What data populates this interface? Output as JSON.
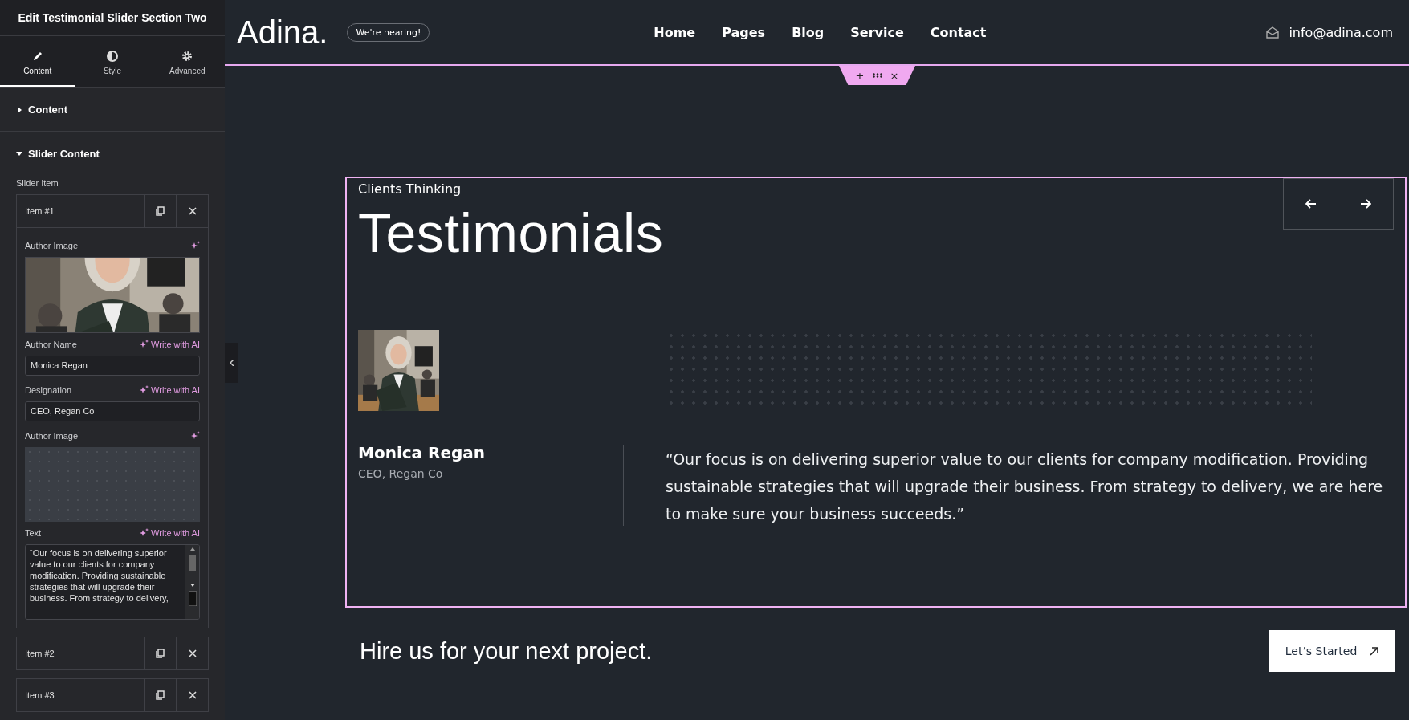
{
  "panel": {
    "title": "Edit Testimonial Slider Section Two",
    "tabs": [
      {
        "label": "Content",
        "selected": true
      },
      {
        "label": "Style",
        "selected": false
      },
      {
        "label": "Advanced",
        "selected": false
      }
    ],
    "sections": [
      {
        "title": "Content",
        "expanded": false
      },
      {
        "title": "Slider Content",
        "expanded": true
      }
    ],
    "repeater_label": "Slider Item",
    "items": [
      {
        "label": "Item #1",
        "fields": [
          {
            "label": "Author Image"
          },
          {
            "kind": "text",
            "label": "Author Name",
            "ai": "Write with AI",
            "value": "Monica Regan"
          },
          {
            "kind": "text",
            "label": "Designation",
            "ai": "Write with AI",
            "value": "CEO, Regan Co"
          },
          {
            "kind": "placeholder",
            "label": "Author Image"
          },
          {
            "kind": "textarea",
            "label": "Text",
            "ai": "Write with AI",
            "value": "“Our focus is on delivering superior value to our clients for company modification. Providing sustainable strategies that will upgrade their business. From strategy to delivery,"
          }
        ]
      },
      {
        "label": "Item #2"
      },
      {
        "label": "Item #3"
      }
    ]
  },
  "header": {
    "logo": "Adina.",
    "badge": "We're hearing!",
    "nav": [
      "Home",
      "Pages",
      "Blog",
      "Service",
      "Contact"
    ],
    "email": "info@adina.com"
  },
  "section_toolbar": [
    "+",
    "×"
  ],
  "testimonials": {
    "eyebrow": "Clients Thinking",
    "title": "Testimonials",
    "author": "Monica Regan",
    "designation": "CEO, Regan Co",
    "quote": "“Our focus is on delivering superior value to our clients for company modification. Providing sustainable strategies that will upgrade their business. From strategy to delivery, we are here to make sure your business succeeds.”"
  },
  "cta": {
    "text": "Hire us for your next project.",
    "button": "Let’s Started"
  }
}
